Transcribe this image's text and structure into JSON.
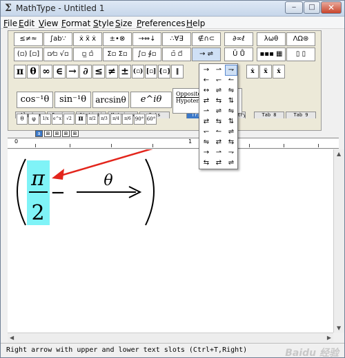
{
  "app": {
    "icon_glyph": "Σ",
    "title": "MathType - Untitled 1",
    "window_buttons": {
      "minimize": "‒",
      "maximize": "□",
      "close": "✕"
    }
  },
  "menubar": [
    "File",
    "Edit",
    "View",
    "Format",
    "Style",
    "Size",
    "Preferences",
    "Help"
  ],
  "palette_row1": [
    "≤≠≈",
    "∫ab∵",
    "ẋ ẍ ẋ",
    "±•⊗",
    "→⇔↓",
    "∴∀∃",
    "∉∩⊂",
    "∂∞ℓ",
    "λωθ",
    "ΛΩ⊛"
  ],
  "palette_row2": [
    "(▫) [▫]",
    "▫⁄▫ √▫",
    "▫̲ ▫̂",
    "Σ▫ Σ▫",
    "∫▫ ∮▫",
    "▫̄ ▫⃗",
    "→ ⇌",
    "Ũ Ů",
    "▪▪▪ ▦",
    "▯ ▯"
  ],
  "symbol_row": [
    "π",
    "θ",
    "∞",
    "∈",
    "→",
    "∂",
    "≤",
    "≠",
    "±",
    "(▫)",
    "[▫]",
    "{▫}",
    "‖",
    "ẋ",
    "ẍ",
    "ẋ"
  ],
  "tabs": [
    "Algebra",
    "Derivs",
    "Statisti",
    "Matrices",
    "Sets",
    "Trig",
    "Geometry",
    "Tab 8",
    "Tab 9"
  ],
  "template_row": [
    "cos⁻¹θ",
    "sin⁻¹θ",
    "arcsinθ",
    "e^iθ"
  ],
  "opposite_hypotenuse": {
    "top": "Opposite",
    "bottom": "Hypotenuse"
  },
  "small_row": [
    "θ",
    "φ",
    "1/x",
    "e^x",
    "√2",
    "π",
    "π/2",
    "π/3",
    "π/4",
    "π/6",
    "90°",
    "60°"
  ],
  "dropdown_rows": [
    [
      "→",
      "⇀",
      "⇁"
    ],
    [
      "←",
      "↽",
      "↼"
    ],
    [
      "↔",
      "⇌",
      "⇋"
    ],
    [
      "⇄",
      "⇆",
      "⇅"
    ],
    [
      "⇀",
      "⇌",
      "⇋"
    ],
    [
      "⇄",
      "⇆",
      "⇅"
    ],
    [
      "↽",
      "↼",
      "⇌"
    ],
    [
      "⇋",
      "⇄",
      "⇆"
    ],
    [
      "→",
      "⇀",
      "⇁"
    ],
    [
      "⇆",
      "⇄",
      "⇌"
    ]
  ],
  "minitool": [
    "a",
    "⊞",
    "⊞",
    "⊞",
    "⊞"
  ],
  "ruler_labels": [
    "0",
    "1"
  ],
  "equation": {
    "numerator": "π",
    "denominator": "2",
    "minus": "−",
    "arrow_label": "θ",
    "arrow": "→"
  },
  "colors": {
    "highlight": "#7ff3f7",
    "annotation_arrow": "#e3251c",
    "active_tab": "#3b78c8"
  },
  "statusbar": {
    "text": "Right arrow with upper and lower text slots (Ctrl+T,Right)"
  },
  "watermark": "Baidu 经验"
}
